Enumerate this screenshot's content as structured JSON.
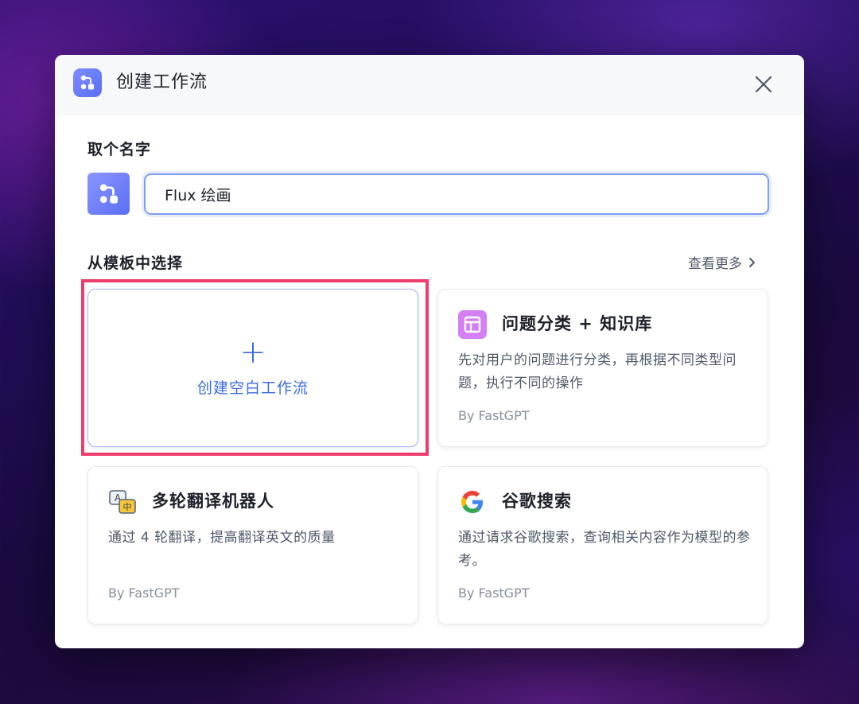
{
  "dialog": {
    "title": "创建工作流",
    "name_section_label": "取个名字",
    "name_value": "Flux 绘画",
    "template_section_label": "从模板中选择",
    "see_more_label": "查看更多"
  },
  "blank_template": {
    "plus_glyph": "+",
    "label": "创建空白工作流"
  },
  "templates": [
    {
      "title": "问题分类 + 知识库",
      "description": "先对用户的问题进行分类，再根据不同类型问题，执行不同的操作",
      "author": "By FastGPT",
      "icon": "layout-grid-icon",
      "icon_color": "#d57ff5"
    },
    {
      "title": "多轮翻译机器人",
      "description": "通过 4 轮翻译，提高翻译英文的质量",
      "author": "By FastGPT",
      "icon": "translate-icon",
      "icon_glyphs": [
        "A",
        "中"
      ]
    },
    {
      "title": "谷歌搜索",
      "description": "通过请求谷歌搜索，查询相关内容作为模型的参考。",
      "author": "By FastGPT",
      "icon": "google-icon",
      "icon_glyphs": [
        "G"
      ]
    }
  ],
  "colors": {
    "accent": "#3a6ae0",
    "highlight": "#ec3d6d",
    "workflow_icon": "#5b6ef5"
  }
}
